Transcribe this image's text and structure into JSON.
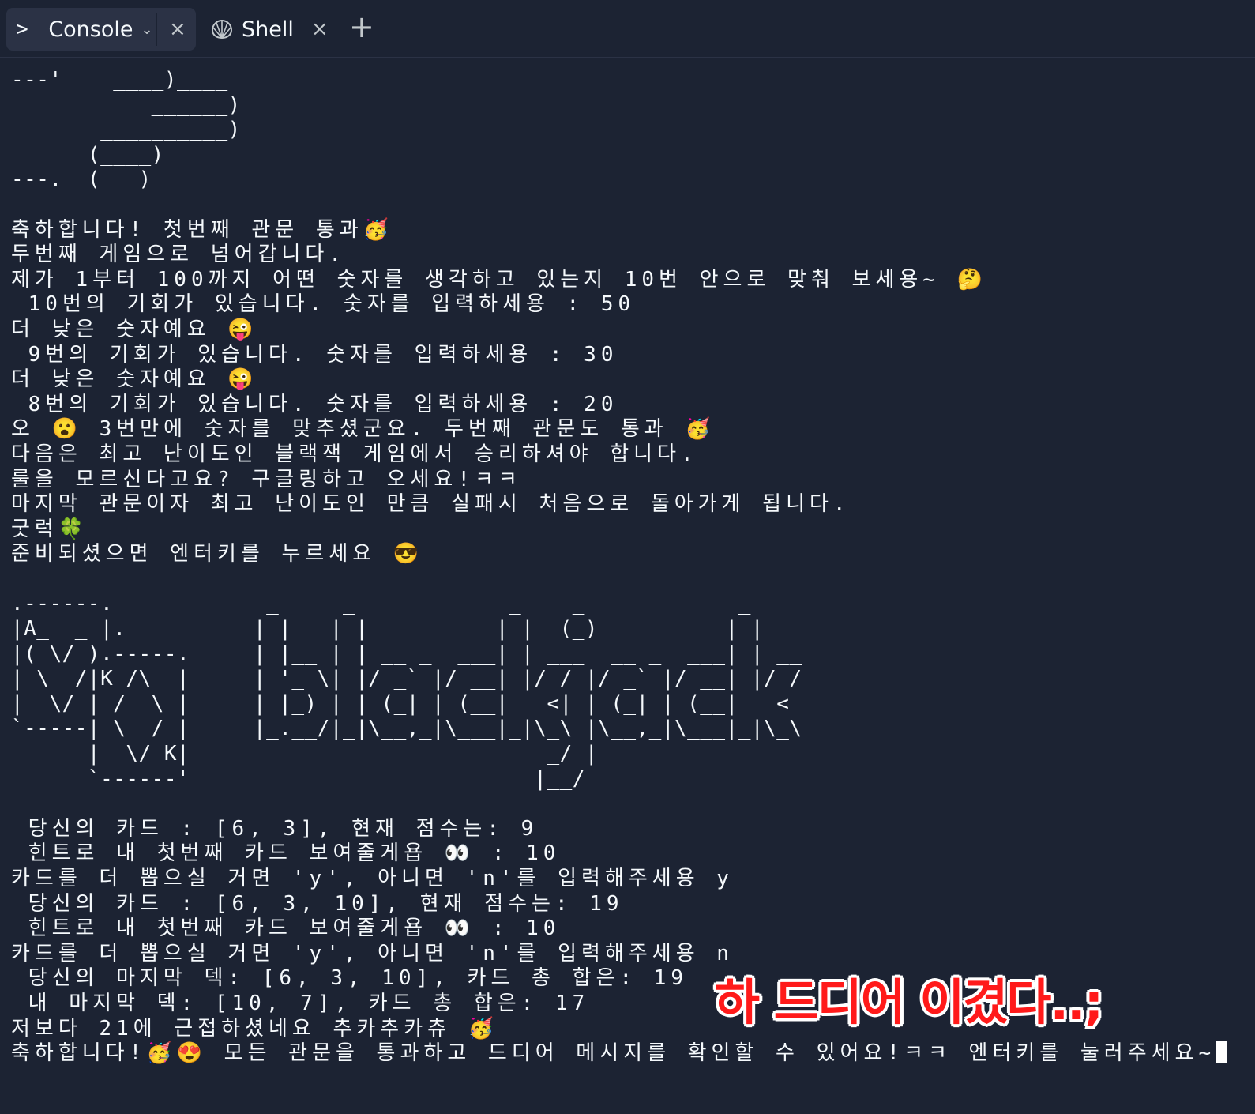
{
  "tabs": {
    "console": {
      "label": "Console",
      "icon": "terminal-prompt-icon"
    },
    "shell": {
      "label": "Shell",
      "icon": "shell-icon"
    }
  },
  "terminal_lines": [
    "---'    ____)____",
    "           ______)",
    "       __________)",
    "      (____)",
    "---.__(___)",
    "",
    "축하합니다! 첫번째 관문 통과🥳",
    "두번째 게임으로 넘어갑니다.",
    "제가 1부터 100까지 어떤 숫자를 생각하고 있는지 10번 안으로 맞춰 보세용~ 🤔",
    " 10번의 기회가 있습니다. 숫자를 입력하세용 : 50",
    "더 낮은 숫자예요 😜",
    " 9번의 기회가 있습니다. 숫자를 입력하세용 : 30",
    "더 낮은 숫자예요 😜",
    " 8번의 기회가 있습니다. 숫자를 입력하세용 : 20",
    "오 😮 3번만에 숫자를 맞추셨군요. 두번째 관문도 통과 🥳",
    "다음은 최고 난이도인 블랙잭 게임에서 승리하셔야 합니다.",
    "룰을 모르신다고요? 구글링하고 오세요!ㅋㅋ",
    "마지막 관문이자 최고 난이도인 만큼 실패시 처음으로 돌아가게 됩니다.",
    "굿럭🍀",
    "준비되셨으면 엔터키를 누르세요 😎",
    "",
    ".------.            _     _            _    _            _",
    "|A_  _ |.          | |   | |          | |  (_)          | |",
    "|( \\/ ).-----.     | |__ | | __ _  ___| | ___  __ _  ___| | __",
    "| \\  /|K /\\  |     | '_ \\| |/ _` |/ __| |/ / |/ _` |/ __| |/ /",
    "|  \\/ | /  \\ |     | |_) | | (_| | (__|   <| | (_| | (__|   <",
    "`-----| \\  / |     |_.__/|_|\\__,_|\\___|_|\\_\\ |\\__,_|\\___|_|\\_\\",
    "      |  \\/ K|                            _/ |",
    "      `------'                           |__/",
    "",
    " 당신의 카드 : [6, 3], 현재 점수는: 9",
    " 힌트로 내 첫번째 카드 보여줄게욥 👀 : 10",
    "카드를 더 뽑으실 거면 'y', 아니면 'n'를 입력해주세용 y",
    " 당신의 카드 : [6, 3, 10], 현재 점수는: 19",
    " 힌트로 내 첫번째 카드 보여줄게욥 👀 : 10",
    "카드를 더 뽑으실 거면 'y', 아니면 'n'를 입력해주세용 n",
    " 당신의 마지막 덱: [6, 3, 10], 카드 총 합은: 19",
    " 내 마지막 덱: [10, 7], 카드 총 합은: 17",
    "저보다 21에 근접하셨네요 추카추카츄 🥳",
    "축하합니다!🥳😍 모든 관문을 통과하고 드디어 메시지를 확인할 수 있어요!ㅋㅋ 엔터키를 눌러주세요~"
  ],
  "overlay_text": "하 드디어 이겼다..;",
  "colors": {
    "background": "#1c2333",
    "text": "#f5f9fc",
    "overlay": "#ff1a1a"
  }
}
